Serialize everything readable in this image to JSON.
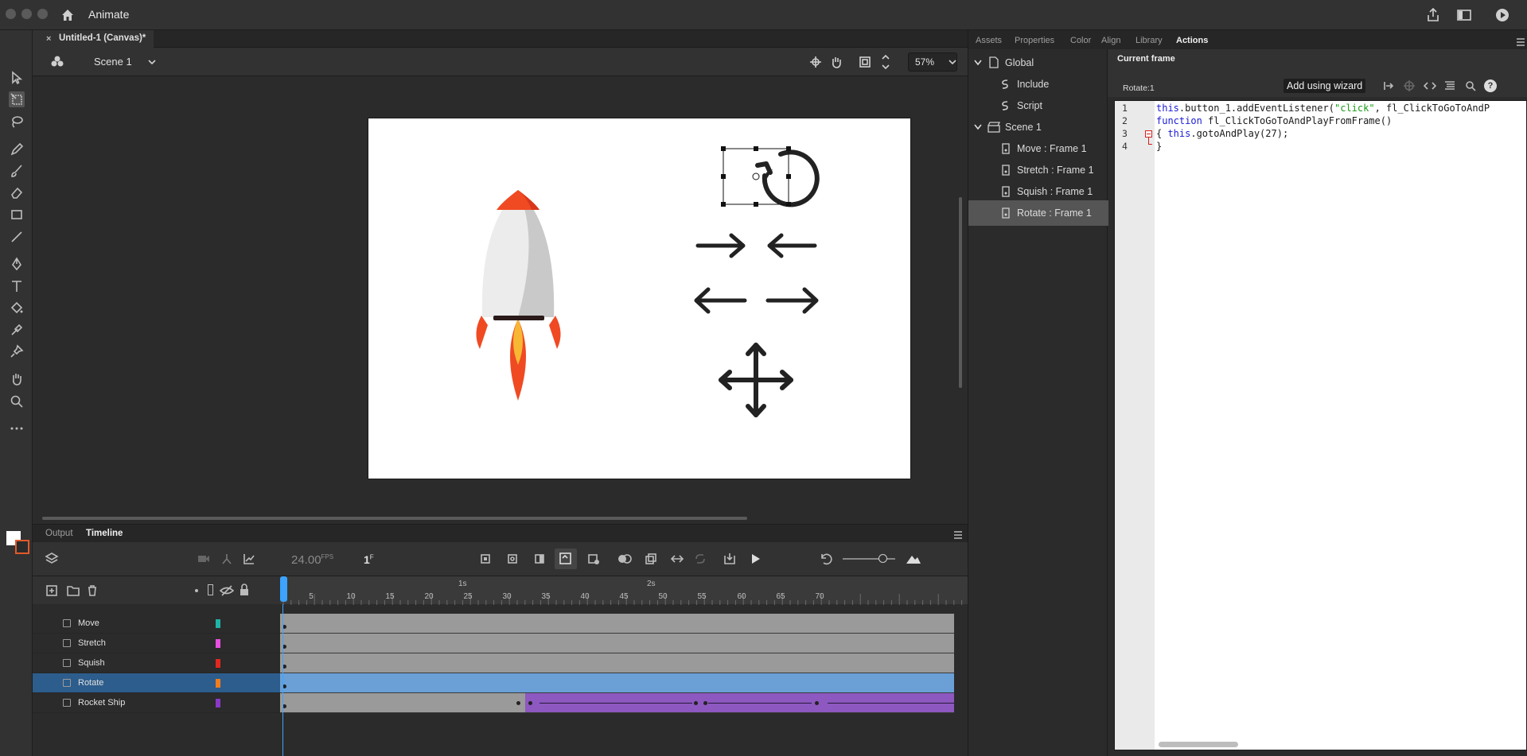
{
  "app": {
    "name": "Animate"
  },
  "document": {
    "tab_title": "Untitled-1 (Canvas)*",
    "close": "×"
  },
  "scene": {
    "name": "Scene 1",
    "zoom": "57%"
  },
  "bottom_panel": {
    "tabs": [
      "Output",
      "Timeline"
    ],
    "active_tab": "Timeline",
    "fps": "24.00",
    "fps_unit": "FPS",
    "current_frame": "1",
    "frame_unit": "F"
  },
  "timeline": {
    "ruler_ticks": [
      "5",
      "10",
      "15",
      "20",
      "25",
      "30",
      "35",
      "40",
      "45",
      "50",
      "55",
      "60",
      "65",
      "70"
    ],
    "seconds_labels": [
      "1s",
      "2s"
    ],
    "layers": [
      {
        "name": "Move",
        "color": "#1fb3a7",
        "selected": false
      },
      {
        "name": "Stretch",
        "color": "#e84fe0",
        "selected": false
      },
      {
        "name": "Squish",
        "color": "#e0281e",
        "selected": false
      },
      {
        "name": "Rotate",
        "color": "#ef7d1f",
        "selected": true
      },
      {
        "name": "Rocket Ship",
        "color": "#8a38c8",
        "selected": false
      }
    ]
  },
  "right_panel": {
    "tabs": [
      "Assets",
      "Properties",
      "Color",
      "Align",
      "Library",
      "Actions"
    ],
    "active_tab": "Actions",
    "tree": [
      {
        "label": "Global",
        "level": 0
      },
      {
        "label": "Include",
        "level": 1
      },
      {
        "label": "Script",
        "level": 1
      },
      {
        "label": "Scene 1",
        "level": 0
      },
      {
        "label": "Move : Frame 1",
        "level": 1
      },
      {
        "label": "Stretch : Frame 1",
        "level": 1
      },
      {
        "label": "Squish : Frame 1",
        "level": 1
      },
      {
        "label": "Rotate : Frame 1",
        "level": 1,
        "selected": true
      }
    ],
    "current_frame_label": "Current frame",
    "frame_ref": "Rotate:1",
    "wizard_button": "Add using wizard",
    "code": {
      "line_numbers": [
        "1",
        "2",
        "3",
        "4"
      ],
      "line1_a": "this",
      "line1_b": ".button_1.addEventListener(",
      "line1_str": "\"click\"",
      "line1_c": ", fl_ClickToGoToAndP",
      "line2_kw": "function",
      "line2_rest": " fl_ClickToGoToAndPlayFromFrame()",
      "line3_a": "{ ",
      "line3_kw": "this",
      "line3_rest": ".gotoAndPlay(27);",
      "line4": "}"
    }
  }
}
